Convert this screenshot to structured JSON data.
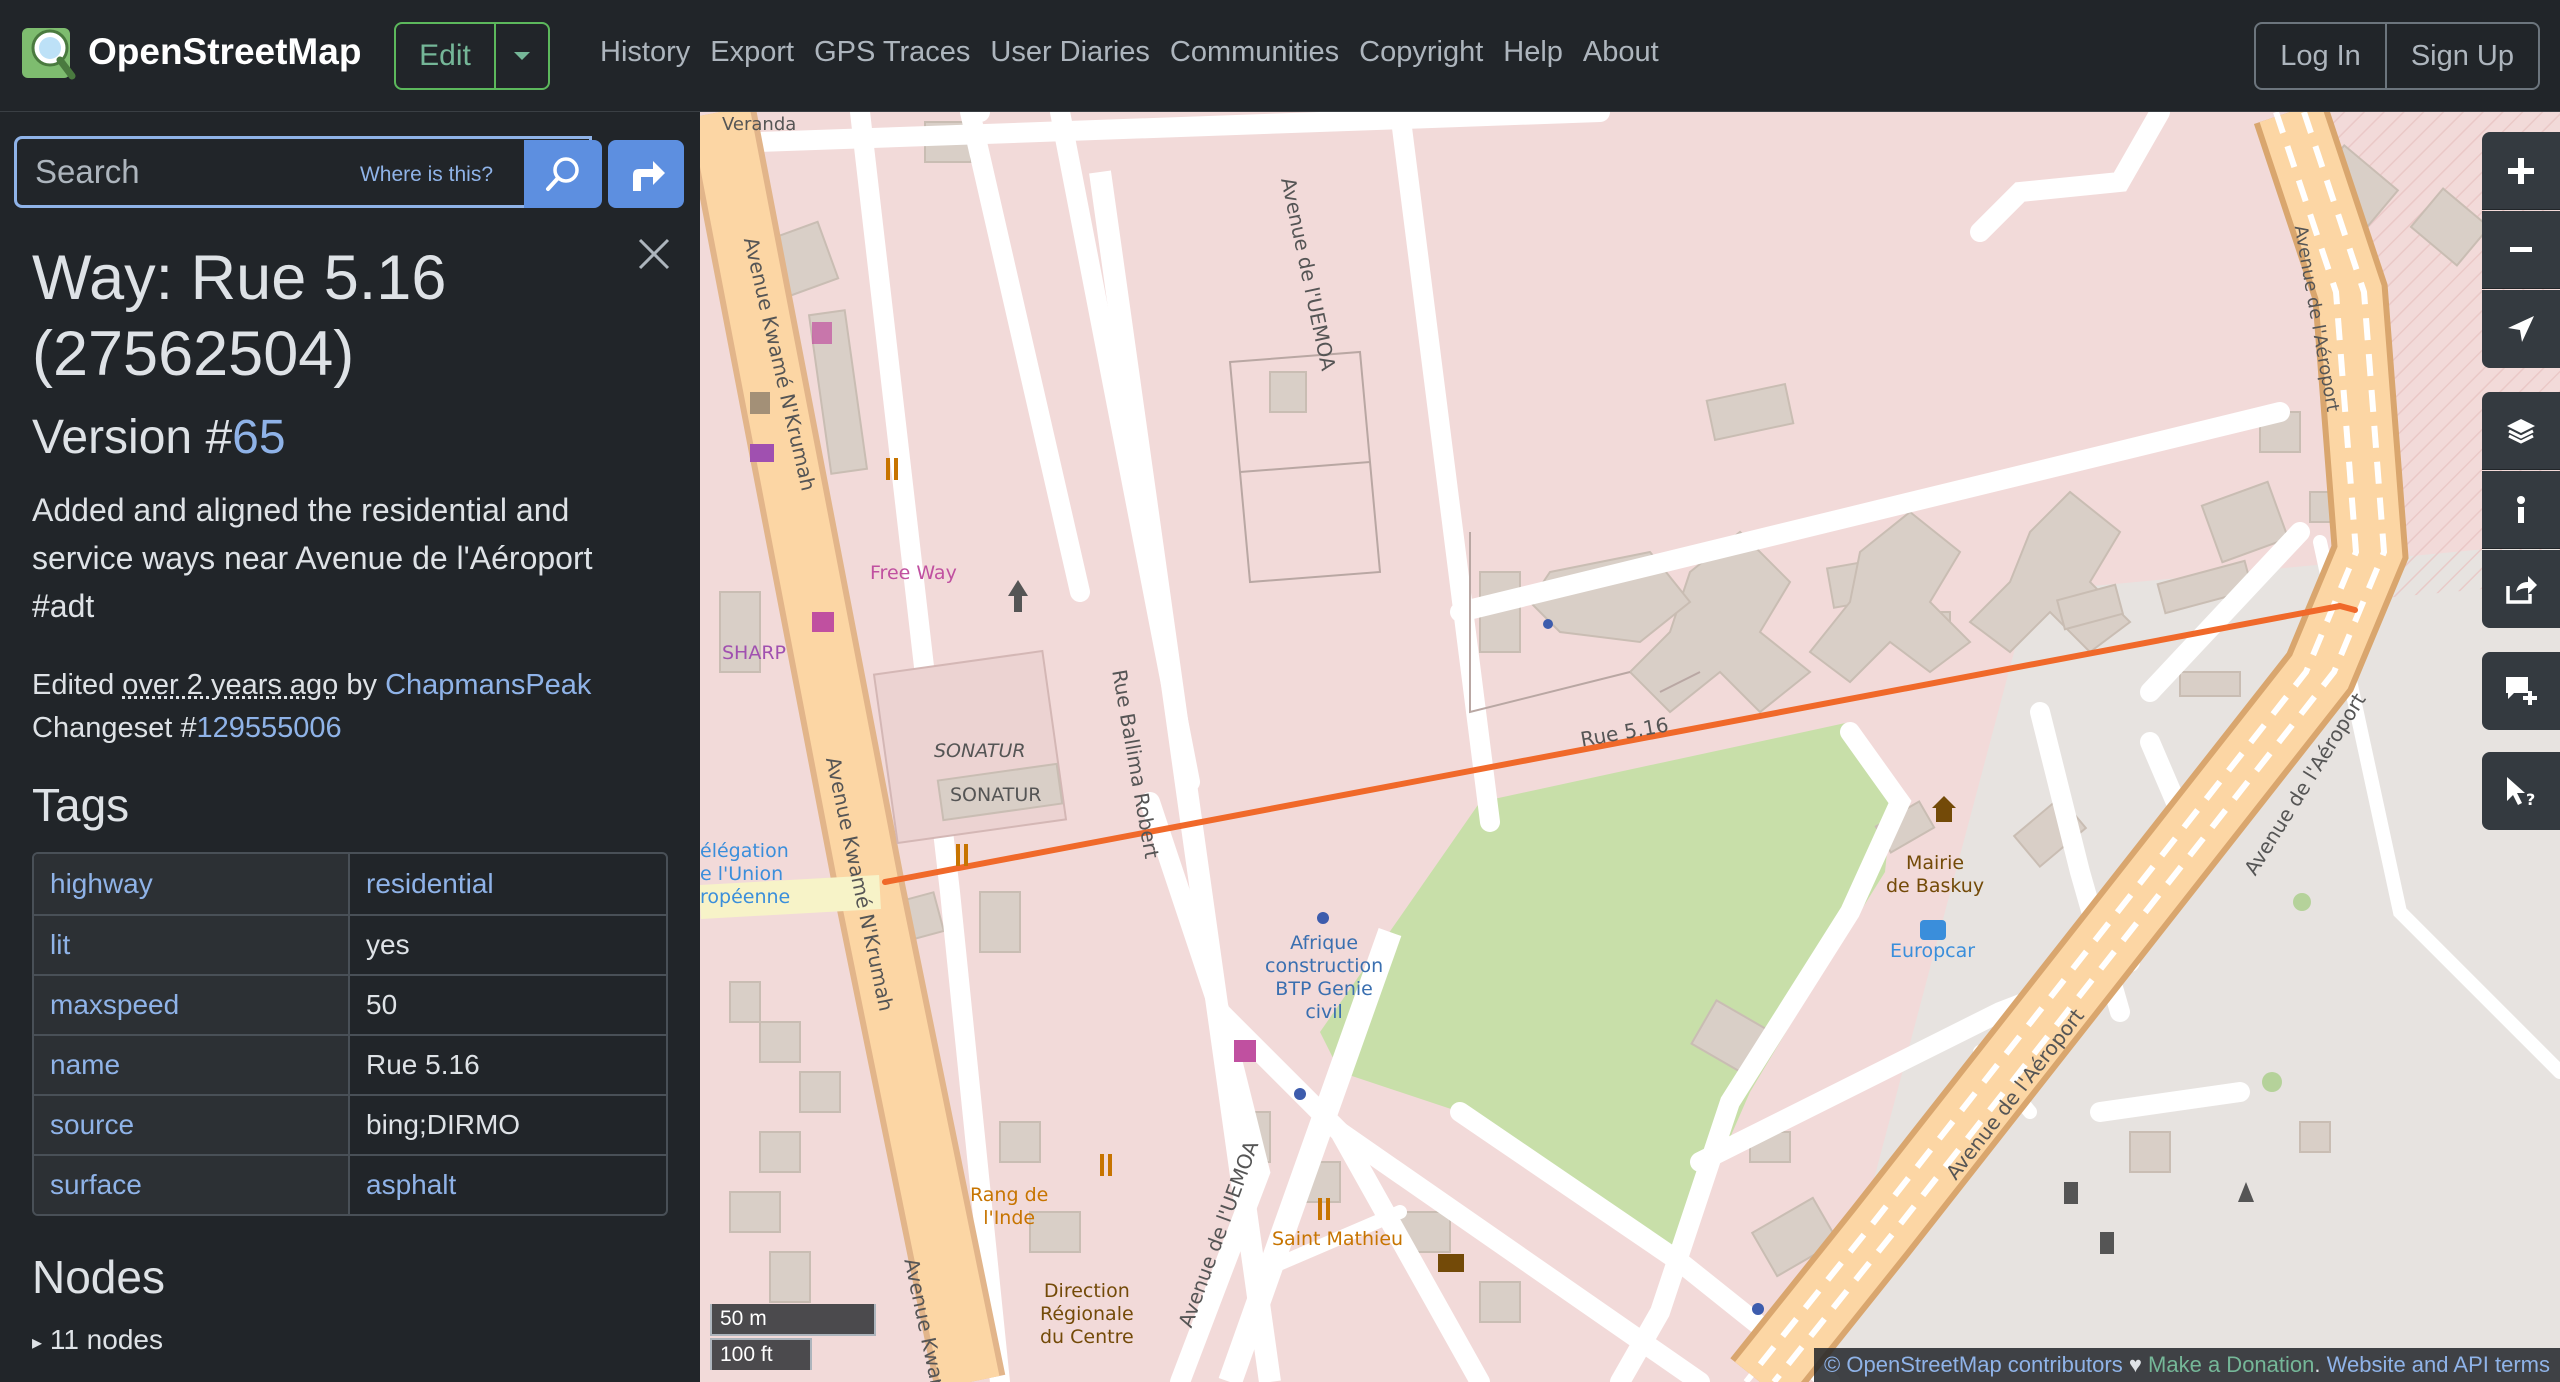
{
  "header": {
    "brand": "OpenStreetMap",
    "edit_label": "Edit",
    "nav": [
      "History",
      "Export",
      "GPS Traces",
      "User Diaries",
      "Communities",
      "Copyright",
      "Help",
      "About"
    ],
    "login": "Log In",
    "signup": "Sign Up"
  },
  "search": {
    "placeholder": "Search",
    "where_link": "Where is this?"
  },
  "feature": {
    "title": "Way: Rue 5.16 (27562504)",
    "version_prefix": "Version #",
    "version_number": "65",
    "comment": "Added and aligned the residential and service ways near Avenue de l'Aéroport #adt",
    "edited_prefix": "Edited",
    "edited_time": "over 2 years ago",
    "edited_by": "by",
    "editor": "ChapmansPeak",
    "changeset_prefix": "Changeset #",
    "changeset_id": "129555006"
  },
  "tags": {
    "heading": "Tags",
    "rows": [
      {
        "key": "highway",
        "value": "residential",
        "value_link": true
      },
      {
        "key": "lit",
        "value": "yes",
        "value_link": false
      },
      {
        "key": "maxspeed",
        "value": "50",
        "value_link": false
      },
      {
        "key": "name",
        "value": "Rue 5.16",
        "value_link": false
      },
      {
        "key": "source",
        "value": "bing;DIRMO",
        "value_link": false
      },
      {
        "key": "surface",
        "value": "asphalt",
        "value_link": true
      }
    ]
  },
  "nodes": {
    "heading": "Nodes",
    "summary": "11 nodes"
  },
  "map": {
    "street_labels": {
      "veranda": "Veranda",
      "kwame1": "Avenue Kwamé N'Krumah",
      "kwame2": "Avenue Kwamé N'Krumah",
      "kwame3": "Avenue Kwamé",
      "uemoa1": "Avenue de l'UEMOA",
      "uemoa2": "Avenue de l'UEMOA",
      "ballima": "Rue Ballima Robert",
      "rue516": "Rue 5.16",
      "aeroport1": "Avenue de l'Aéroport",
      "aeroport2": "Avenue de l'Aéroport",
      "aeroport3": "Avenue de l'Aéroport"
    },
    "poi_labels": {
      "free_way": "Free Way",
      "sharp": "SHARP",
      "sonatur1": "SONATUR",
      "sonatur2": "SONATUR",
      "delegation": "élégation\ne l'Union\nropéenne",
      "afrique": "Afrique\nconstruction\nBTP Genie\ncivil",
      "rang": "Rang de\nl'Inde",
      "direction": "Direction\nRégionale\ndu Centre",
      "saint": "Saint Mathieu",
      "mairie": "Mairie\nde Baskuy",
      "europcar": "Europcar"
    },
    "scale_m": "50 m",
    "scale_ft": "100 ft",
    "attribution": {
      "contrib": "© OpenStreetMap contributors",
      "heart": "♥",
      "donate": "Make a Donation",
      "sep": ".",
      "terms": "Website and API terms"
    }
  },
  "colors": {
    "highlight": "#f0692a",
    "primary_road": "#fcd6a4",
    "residential_area": "#f2dad9",
    "park": "#c8dfa9",
    "building": "#d9cfc7",
    "link": "#8fb3e8"
  }
}
